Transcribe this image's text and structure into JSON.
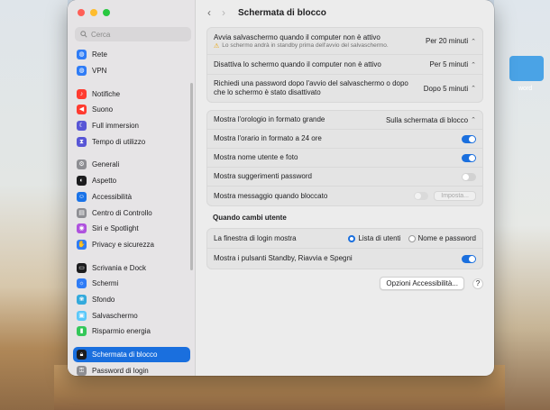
{
  "desktop": {
    "folder_label": "word"
  },
  "sidebar": {
    "search_placeholder": "Cerca",
    "groups": [
      {
        "items": [
          {
            "label": "Rete",
            "icon": "globe-icon",
            "color": "#2f7cf6"
          },
          {
            "label": "VPN",
            "icon": "globe-icon",
            "color": "#2f7cf6"
          }
        ]
      },
      {
        "items": [
          {
            "label": "Notifiche",
            "icon": "bell-icon",
            "color": "#ff3b30"
          },
          {
            "label": "Suono",
            "icon": "speaker-icon",
            "color": "#ff3b30"
          },
          {
            "label": "Full immersion",
            "icon": "moon-icon",
            "color": "#5856d6"
          },
          {
            "label": "Tempo di utilizzo",
            "icon": "hourglass-icon",
            "color": "#5856d6"
          }
        ]
      },
      {
        "items": [
          {
            "label": "Generali",
            "icon": "gear-icon",
            "color": "#8e8e93"
          },
          {
            "label": "Aspetto",
            "icon": "appearance-icon",
            "color": "#1c1c1e"
          },
          {
            "label": "Accessibilità",
            "icon": "accessibility-icon",
            "color": "#1a73e8"
          },
          {
            "label": "Centro di Controllo",
            "icon": "control-center-icon",
            "color": "#8e8e93"
          },
          {
            "label": "Siri e Spotlight",
            "icon": "siri-icon",
            "color": "#af52de"
          },
          {
            "label": "Privacy e sicurezza",
            "icon": "hand-icon",
            "color": "#2f7cf6"
          }
        ]
      },
      {
        "items": [
          {
            "label": "Scrivania e Dock",
            "icon": "dock-icon",
            "color": "#1c1c1e"
          },
          {
            "label": "Schermi",
            "icon": "display-icon",
            "color": "#2f7cf6"
          },
          {
            "label": "Sfondo",
            "icon": "wallpaper-icon",
            "color": "#34aadc"
          },
          {
            "label": "Salvaschermo",
            "icon": "screensaver-icon",
            "color": "#5ac8fa"
          },
          {
            "label": "Risparmio energia",
            "icon": "battery-icon",
            "color": "#34c759"
          }
        ]
      },
      {
        "items": [
          {
            "label": "Schermata di blocco",
            "icon": "lock-icon",
            "color": "#1c1c1e",
            "selected": true
          },
          {
            "label": "Password di login",
            "icon": "key-icon",
            "color": "#8e8e93"
          }
        ]
      }
    ]
  },
  "toolbar": {
    "back": "‹",
    "forward": "›",
    "title": "Schermata di blocco"
  },
  "group1": [
    {
      "label": "Avvia salvaschermo quando il computer non è attivo",
      "note": "Lo schermo andrà in standby prima dell'avvio del salvaschermo.",
      "value": "Per 20 minuti"
    },
    {
      "label": "Disattiva lo schermo quando il computer non è attivo",
      "value": "Per 5 minuti"
    },
    {
      "label": "Richiedi una password dopo l'avvio del salvaschermo o dopo che lo schermo è stato disattivato",
      "value": "Dopo 5 minuti"
    }
  ],
  "group2": [
    {
      "label": "Mostra l'orologio in formato grande",
      "type": "popup",
      "value": "Sulla schermata di blocco"
    },
    {
      "label": "Mostra l'orario in formato a 24 ore",
      "type": "toggle",
      "on": true
    },
    {
      "label": "Mostra nome utente e foto",
      "type": "toggle",
      "on": true
    },
    {
      "label": "Mostra suggerimenti password",
      "type": "toggle",
      "on": false
    },
    {
      "label": "Mostra messaggio quando bloccato",
      "type": "toggle-button",
      "on": false,
      "button": "Imposta..."
    }
  ],
  "section_user": {
    "title": "Quando cambi utente",
    "login_label": "La finestra di login mostra",
    "options": [
      "Lista di utenti",
      "Nome e password"
    ],
    "selected": "Lista di utenti",
    "standby_label": "Mostra i pulsanti Standby, Riavvia e Spegni",
    "standby_on": true
  },
  "footer": {
    "accessibility_button": "Opzioni Accessibilità...",
    "help": "?"
  },
  "colors": {
    "accent": "#1a6fde",
    "sidebar_bg": "#e6e4e6",
    "window_bg": "#ececec"
  }
}
